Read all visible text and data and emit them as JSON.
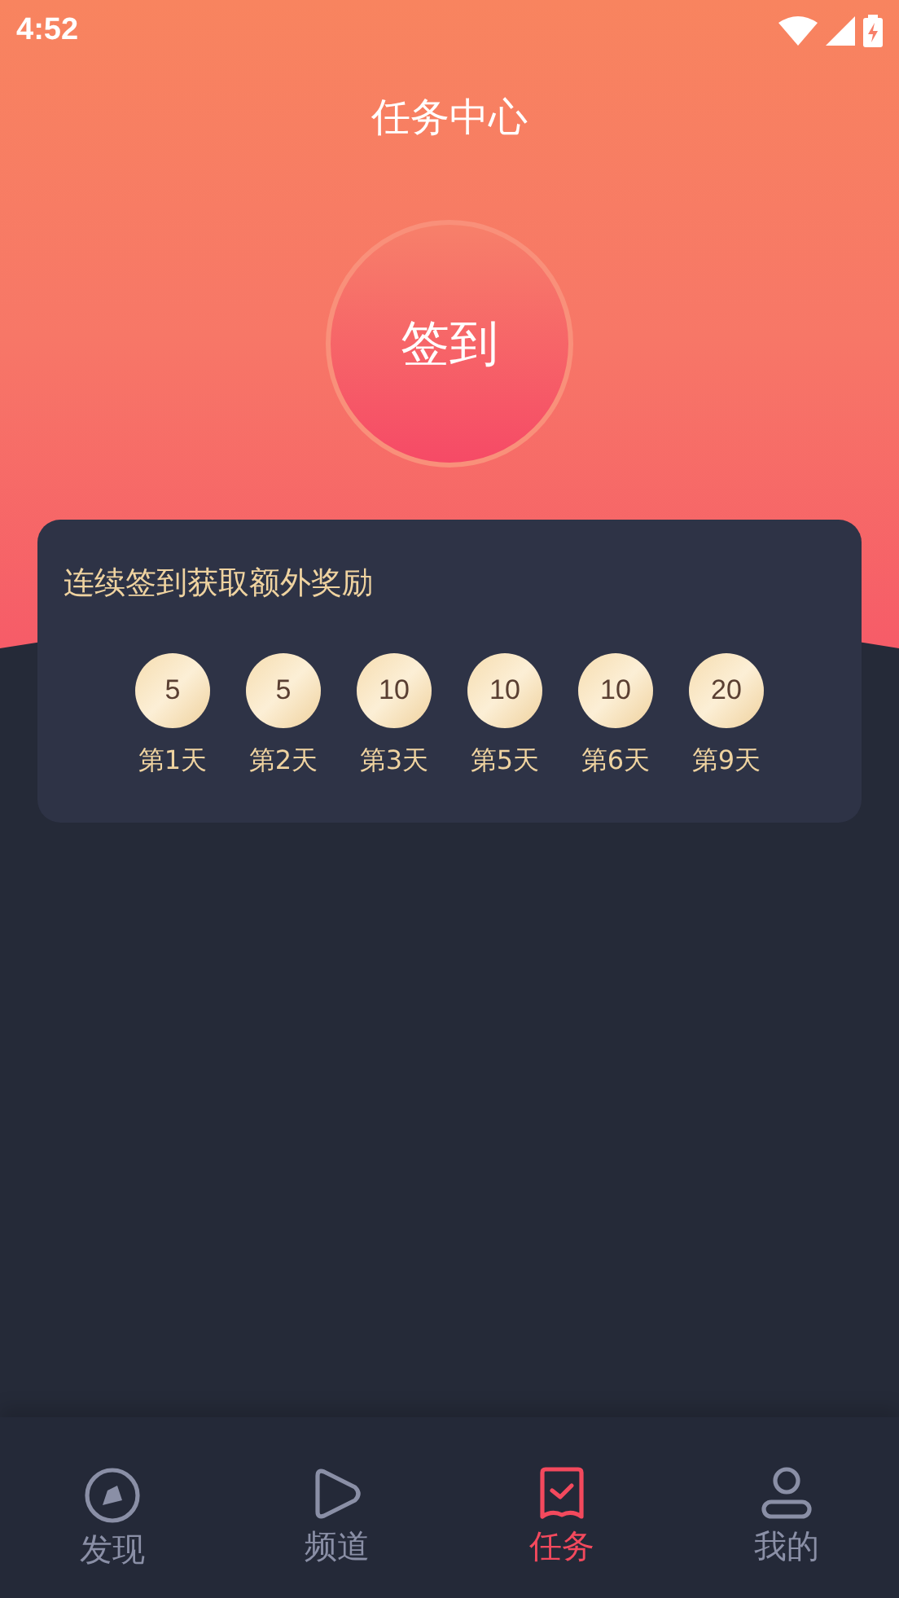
{
  "status_bar": {
    "time": "4:52"
  },
  "header": {
    "title": "任务中心"
  },
  "checkin_button": {
    "label": "签到"
  },
  "rewards_card": {
    "title": "连续签到获取额外奖励",
    "rewards": [
      {
        "amount": "5",
        "day": "第1天"
      },
      {
        "amount": "5",
        "day": "第2天"
      },
      {
        "amount": "10",
        "day": "第3天"
      },
      {
        "amount": "10",
        "day": "第5天"
      },
      {
        "amount": "10",
        "day": "第6天"
      },
      {
        "amount": "20",
        "day": "第9天"
      }
    ]
  },
  "tab_bar": [
    {
      "kind": "compass",
      "label": "发现",
      "selected": false
    },
    {
      "kind": "play",
      "label": "频道",
      "selected": false
    },
    {
      "kind": "task",
      "label": "任务",
      "selected": true
    },
    {
      "kind": "user",
      "label": "我的",
      "selected": false
    }
  ]
}
